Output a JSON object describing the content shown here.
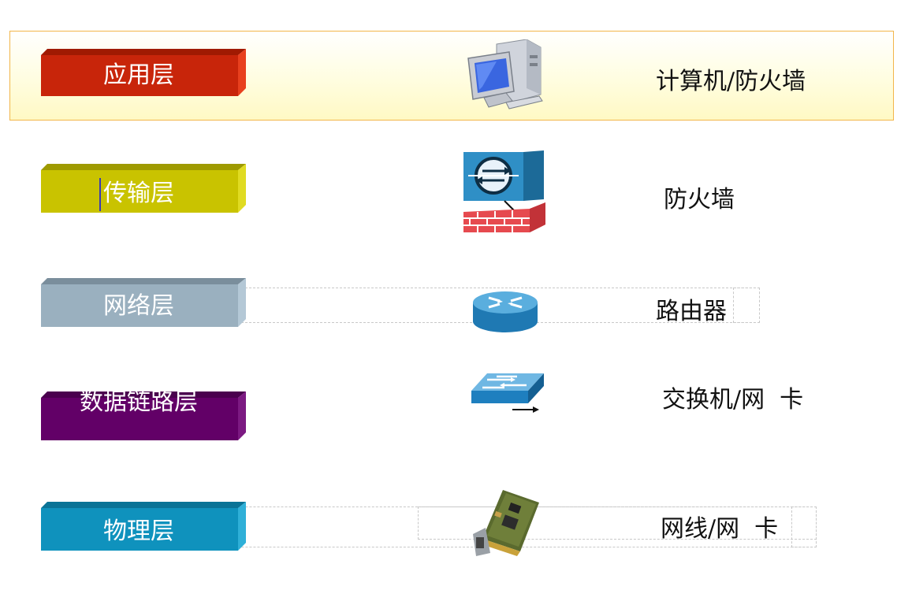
{
  "layers": [
    {
      "id": "application",
      "label": "应用层",
      "device": "计算机/防火墙",
      "color_front": "#c8250a",
      "color_top": "#a01a02",
      "color_side": "#e8401e",
      "icon": "computer-icon"
    },
    {
      "id": "transport",
      "label": "传输层",
      "device": "防火墙",
      "color_front": "#c9c300",
      "color_top": "#9e9a00",
      "color_side": "#e0db22",
      "icon": "firewall-icon"
    },
    {
      "id": "network",
      "label": "网络层",
      "device": "路由器",
      "color_front": "#9ab0bf",
      "color_top": "#7a8e9c",
      "color_side": "#b4c8d6",
      "icon": "router-icon"
    },
    {
      "id": "datalink",
      "label": "数据链路层",
      "device": "交换机/网  卡",
      "color_front": "#620067",
      "color_top": "#4a004e",
      "color_side": "#7c1a82",
      "icon": "switch-icon"
    },
    {
      "id": "physical",
      "label": "物理层",
      "device": "网线/网  卡",
      "color_front": "#0f92bd",
      "color_top": "#0a7396",
      "color_side": "#2fb0d8",
      "icon": "network-card-icon"
    }
  ]
}
